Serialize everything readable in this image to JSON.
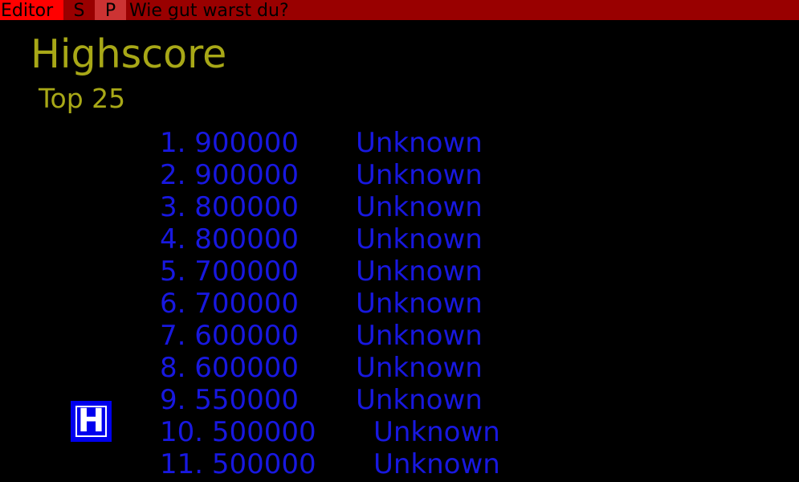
{
  "menubar": {
    "editor_label": "Editor",
    "s_label": "S",
    "p_label": "P",
    "status_text": "Wie gut warst du?"
  },
  "heading": {
    "title": "Highscore",
    "subtitle": "Top 25"
  },
  "scores": [
    {
      "rank": "1.",
      "score": "900000",
      "name": "Unknown"
    },
    {
      "rank": "2.",
      "score": "900000",
      "name": "Unknown"
    },
    {
      "rank": "3.",
      "score": "800000",
      "name": "Unknown"
    },
    {
      "rank": "4.",
      "score": "800000",
      "name": "Unknown"
    },
    {
      "rank": "5.",
      "score": "700000",
      "name": "Unknown"
    },
    {
      "rank": "6.",
      "score": "700000",
      "name": "Unknown"
    },
    {
      "rank": "7.",
      "score": "600000",
      "name": "Unknown"
    },
    {
      "rank": "8.",
      "score": "600000",
      "name": "Unknown"
    },
    {
      "rank": "9.",
      "score": "550000",
      "name": "Unknown"
    },
    {
      "rank": "10.",
      "score": "500000",
      "name": "Unknown"
    },
    {
      "rank": "11.",
      "score": "500000",
      "name": "Unknown"
    }
  ],
  "h_button": {
    "label": "H",
    "icon": "h-icon"
  },
  "colors": {
    "background": "#000000",
    "menubar": "#990000",
    "menu_editor_bg": "#ff0000",
    "menu_p_bg": "#cc3333",
    "heading": "#a8a817",
    "score_text": "#1818e0",
    "h_button_bg": "#0000ee"
  }
}
